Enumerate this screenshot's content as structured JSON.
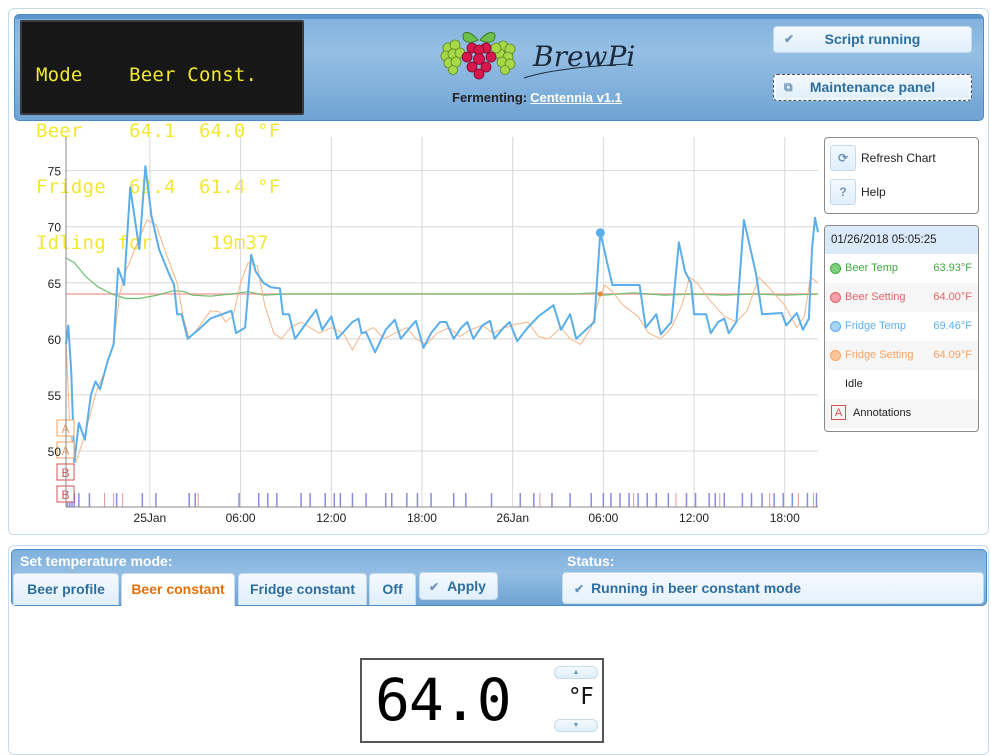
{
  "lcd": {
    "lines": [
      "Mode    Beer Const.",
      "Beer    64.1  64.0 °F",
      "Fridge  62.4  61.4 °F",
      "Idling for     19m37"
    ]
  },
  "header": {
    "logo_text": "BrewPi",
    "fermenting_label": "Fermenting:",
    "beer_name": "Centennia v1.1",
    "script_status_button": "Script running",
    "maintenance_button": "Maintenance panel"
  },
  "chart_controls": {
    "refresh_label": "Refresh Chart",
    "help_label": "Help",
    "help_icon": "?"
  },
  "legend": {
    "timestamp": "01/26/2018 05:05:25",
    "items": [
      {
        "name": "Beer Temp",
        "value": "63.93°F",
        "color": "#41a941"
      },
      {
        "name": "Beer Setting",
        "value": "64.00°F",
        "color": "#e2636b"
      },
      {
        "name": "Fridge Temp",
        "value": "69.46°F",
        "color": "#5bb0ea"
      },
      {
        "name": "Fridge Setting",
        "value": "64.09°F",
        "color": "#f5a35f"
      }
    ],
    "state": "Idle",
    "annotations_label": "Annotations",
    "annotations_icon": "A"
  },
  "chart_data": {
    "type": "line",
    "title": "",
    "xlabel": "",
    "ylabel": "",
    "x_unit": "hours since 24 Jan 00:00",
    "xlim": [
      18.45,
      68.2
    ],
    "ylim": [
      45,
      78
    ],
    "y_ticks": [
      50,
      55,
      60,
      65,
      70,
      75
    ],
    "x_ticks": [
      {
        "x": 24,
        "label": "25Jan"
      },
      {
        "x": 30,
        "label": "06:00"
      },
      {
        "x": 36,
        "label": "12:00"
      },
      {
        "x": 42,
        "label": "18:00"
      },
      {
        "x": 48,
        "label": "26Jan"
      },
      {
        "x": 54,
        "label": "06:00"
      },
      {
        "x": 60,
        "label": "12:00"
      },
      {
        "x": 66,
        "label": "18:00"
      }
    ],
    "grid": true,
    "legend_position": "right",
    "series": [
      {
        "name": "Beer Setting",
        "color": "#f4a6a6",
        "points": [
          [
            18.45,
            64.0
          ],
          [
            68.2,
            64.0
          ]
        ]
      },
      {
        "name": "Beer Temp",
        "color": "#6cbf6c",
        "points": [
          [
            18.45,
            67.2
          ],
          [
            19.0,
            66.8
          ],
          [
            19.8,
            65.5
          ],
          [
            20.6,
            64.6
          ],
          [
            21.5,
            64.0
          ],
          [
            22.4,
            63.6
          ],
          [
            23.3,
            63.6
          ],
          [
            24.5,
            63.9
          ],
          [
            25.6,
            64.3
          ],
          [
            26.3,
            64.2
          ],
          [
            26.8,
            63.9
          ],
          [
            28.0,
            63.8
          ],
          [
            29.4,
            64.0
          ],
          [
            30.5,
            64.2
          ],
          [
            31.5,
            63.9
          ],
          [
            33,
            64.0
          ],
          [
            36,
            64.0
          ],
          [
            40,
            64.0
          ],
          [
            44,
            64.0
          ],
          [
            48,
            64.0
          ],
          [
            52,
            64.0
          ],
          [
            53.5,
            64.1
          ],
          [
            54.0,
            63.9
          ],
          [
            56,
            64.1
          ],
          [
            58,
            63.9
          ],
          [
            60,
            64.0
          ],
          [
            62,
            63.9
          ],
          [
            64,
            64.0
          ],
          [
            66,
            63.9
          ],
          [
            68.2,
            64.0
          ]
        ]
      },
      {
        "name": "Fridge Setting",
        "color": "#f7b586",
        "points": [
          [
            18.45,
            60
          ],
          [
            18.7,
            52
          ],
          [
            19.1,
            49
          ],
          [
            19.6,
            51
          ],
          [
            20.0,
            53
          ],
          [
            20.5,
            55.5
          ],
          [
            21.0,
            57
          ],
          [
            21.6,
            59.5
          ],
          [
            22.0,
            64
          ],
          [
            22.4,
            66
          ],
          [
            23.0,
            68
          ],
          [
            23.8,
            70.6
          ],
          [
            24.4,
            70.2
          ],
          [
            25.1,
            67.5
          ],
          [
            25.8,
            65
          ],
          [
            26.2,
            62
          ],
          [
            26.6,
            60
          ],
          [
            27.2,
            61
          ],
          [
            28.0,
            62.5
          ],
          [
            28.6,
            62.4
          ],
          [
            29.0,
            61.5
          ],
          [
            29.5,
            62
          ],
          [
            30.0,
            65
          ],
          [
            30.5,
            66.8
          ],
          [
            31.1,
            66.5
          ],
          [
            31.6,
            63
          ],
          [
            32.2,
            60.5
          ],
          [
            32.7,
            60
          ],
          [
            33.3,
            61
          ],
          [
            34.0,
            61.5
          ],
          [
            34.6,
            61
          ],
          [
            35.2,
            60.5
          ],
          [
            36.0,
            61
          ],
          [
            36.8,
            60.5
          ],
          [
            37.4,
            59
          ],
          [
            38.0,
            60.5
          ],
          [
            38.8,
            61
          ],
          [
            39.5,
            60
          ],
          [
            40.2,
            60.5
          ],
          [
            41.0,
            61
          ],
          [
            41.6,
            60
          ],
          [
            42.3,
            59.5
          ],
          [
            43.0,
            60.5
          ],
          [
            43.8,
            61
          ],
          [
            44.5,
            60.2
          ],
          [
            45.2,
            60.8
          ],
          [
            46.0,
            61.2
          ],
          [
            46.7,
            60.5
          ],
          [
            47.5,
            61
          ],
          [
            48.2,
            61.3
          ],
          [
            49.0,
            61.5
          ],
          [
            49.7,
            60.2
          ],
          [
            50.4,
            60
          ],
          [
            51.2,
            61
          ],
          [
            51.8,
            60
          ],
          [
            52.5,
            59.5
          ],
          [
            53.2,
            61
          ],
          [
            53.7,
            63.5
          ],
          [
            54.1,
            64.8
          ],
          [
            54.6,
            64.2
          ],
          [
            55.3,
            63
          ],
          [
            56.3,
            62
          ],
          [
            57.0,
            60.5
          ],
          [
            57.8,
            60
          ],
          [
            58.5,
            61
          ],
          [
            59.2,
            63
          ],
          [
            59.7,
            65.5
          ],
          [
            60.2,
            65
          ],
          [
            61.0,
            63.5
          ],
          [
            62.0,
            62
          ],
          [
            62.8,
            61.5
          ],
          [
            63.5,
            62.5
          ],
          [
            64.3,
            65.5
          ],
          [
            65.0,
            64.5
          ],
          [
            66.0,
            63
          ],
          [
            66.8,
            61
          ],
          [
            67.3,
            62
          ],
          [
            67.7,
            65.5
          ],
          [
            68.2,
            65
          ]
        ]
      },
      {
        "name": "Fridge Temp",
        "color": "#5aaeea",
        "points": [
          [
            18.45,
            59.5
          ],
          [
            18.6,
            61.2
          ],
          [
            18.8,
            57
          ],
          [
            19.0,
            49
          ],
          [
            19.3,
            52.5
          ],
          [
            19.7,
            51
          ],
          [
            20.1,
            55
          ],
          [
            20.4,
            56.2
          ],
          [
            20.7,
            55.5
          ],
          [
            21.2,
            58
          ],
          [
            21.6,
            59.5
          ],
          [
            21.9,
            66.3
          ],
          [
            22.3,
            64.8
          ],
          [
            22.7,
            73.5
          ],
          [
            23.3,
            68
          ],
          [
            23.7,
            75.4
          ],
          [
            24.1,
            71
          ],
          [
            24.6,
            68
          ],
          [
            25.2,
            66
          ],
          [
            25.6,
            64.8
          ],
          [
            25.8,
            62.2
          ],
          [
            26.1,
            62.2
          ],
          [
            26.5,
            60
          ],
          [
            27.2,
            60.8
          ],
          [
            28.0,
            61.8
          ],
          [
            29.0,
            62.3
          ],
          [
            29.4,
            62.5
          ],
          [
            29.7,
            60.5
          ],
          [
            30.3,
            61
          ],
          [
            30.7,
            67.5
          ],
          [
            31.0,
            66
          ],
          [
            31.5,
            65
          ],
          [
            32.0,
            64.6
          ],
          [
            32.6,
            64.5
          ],
          [
            32.8,
            62.2
          ],
          [
            33.2,
            62.2
          ],
          [
            33.6,
            60
          ],
          [
            34.4,
            61.5
          ],
          [
            35.0,
            62.6
          ],
          [
            35.4,
            60.8
          ],
          [
            36.0,
            62
          ],
          [
            36.4,
            60
          ],
          [
            37.4,
            61.5
          ],
          [
            37.8,
            61.8
          ],
          [
            38.0,
            60.5
          ],
          [
            38.3,
            60.6
          ],
          [
            38.9,
            58.8
          ],
          [
            39.6,
            60.8
          ],
          [
            40.2,
            61.7
          ],
          [
            40.6,
            60
          ],
          [
            41.2,
            61
          ],
          [
            41.6,
            61.6
          ],
          [
            42.1,
            59.2
          ],
          [
            42.6,
            60.5
          ],
          [
            43.2,
            61.5
          ],
          [
            43.6,
            61.5
          ],
          [
            44.1,
            60
          ],
          [
            44.6,
            61
          ],
          [
            45.0,
            61.5
          ],
          [
            45.4,
            60
          ],
          [
            46.0,
            61.2
          ],
          [
            46.5,
            61.6
          ],
          [
            46.8,
            60
          ],
          [
            47.4,
            61
          ],
          [
            47.8,
            61.5
          ],
          [
            48.3,
            59.8
          ],
          [
            49.0,
            61
          ],
          [
            49.7,
            62
          ],
          [
            50.7,
            63
          ],
          [
            51.2,
            60.8
          ],
          [
            51.8,
            62.2
          ],
          [
            52.2,
            60
          ],
          [
            53.0,
            61
          ],
          [
            53.4,
            61.5
          ],
          [
            53.8,
            69.5
          ],
          [
            54.3,
            66.5
          ],
          [
            54.6,
            64.8
          ],
          [
            55.2,
            64.8
          ],
          [
            56.4,
            64.8
          ],
          [
            56.8,
            61
          ],
          [
            57.5,
            62.2
          ],
          [
            57.8,
            60.4
          ],
          [
            58.5,
            61.5
          ],
          [
            59.0,
            68.6
          ],
          [
            59.4,
            66
          ],
          [
            59.8,
            65
          ],
          [
            60.0,
            62.2
          ],
          [
            60.8,
            62.2
          ],
          [
            61.1,
            60.5
          ],
          [
            61.6,
            61.5
          ],
          [
            62.0,
            61.8
          ],
          [
            62.3,
            60.5
          ],
          [
            62.8,
            61.5
          ],
          [
            63.3,
            70.6
          ],
          [
            63.8,
            67.6
          ],
          [
            64.1,
            65.8
          ],
          [
            64.5,
            62.2
          ],
          [
            65.8,
            62.3
          ],
          [
            66.1,
            61.2
          ],
          [
            66.8,
            62.3
          ],
          [
            67.2,
            60.8
          ],
          [
            67.6,
            61.8
          ],
          [
            67.8,
            68
          ],
          [
            68.0,
            70.8
          ],
          [
            68.2,
            69.5
          ]
        ]
      }
    ],
    "highlight_point": {
      "series": "Fridge Temp",
      "x": 53.8,
      "y": 69.46
    },
    "annotations": [
      {
        "label": "A",
        "color": "#f2a05a"
      },
      {
        "label": "A",
        "color": "#f2a05a"
      },
      {
        "label": "B",
        "color": "#d65050"
      },
      {
        "label": "B",
        "color": "#d65050"
      }
    ],
    "state_markers": {
      "cooling_color": "#8a8ae0",
      "heating_color": "#e39a9a",
      "cooling_x": [
        18.55,
        18.7,
        18.85,
        19.0,
        19.3,
        20.0,
        21.8,
        23.5,
        24.4,
        26.6,
        27.0,
        29.9,
        31.2,
        31.8,
        32.4,
        34.0,
        34.6,
        35.6,
        36.2,
        36.6,
        37.4,
        38.3,
        39.6,
        40.0,
        41.0,
        41.7,
        42.6,
        44.1,
        44.9,
        46.6,
        48.5,
        49.4,
        50.6,
        51.8,
        53.2,
        54.0,
        54.5,
        55.1,
        55.7,
        56.3,
        56.9,
        57.5,
        58.3,
        59.5,
        60.1,
        61.0,
        61.4,
        62.0,
        63.2,
        63.8,
        64.5,
        65.3,
        65.9,
        66.5,
        67.5,
        68.1
      ],
      "heating_x": [
        21.0,
        21.6,
        22.2,
        27.2,
        49.8,
        56.0,
        58.8,
        61.7,
        65.0,
        66.9,
        67.9
      ]
    }
  },
  "mode_panel": {
    "title": "Set temperature mode:",
    "tabs": [
      "Beer profile",
      "Beer constant",
      "Fridge constant",
      "Off"
    ],
    "active_tab": "Beer constant",
    "apply_label": "Apply",
    "status_title": "Status:",
    "status_text": "Running in beer constant mode",
    "setpoint_value": "64.0",
    "setpoint_unit": "°F"
  }
}
